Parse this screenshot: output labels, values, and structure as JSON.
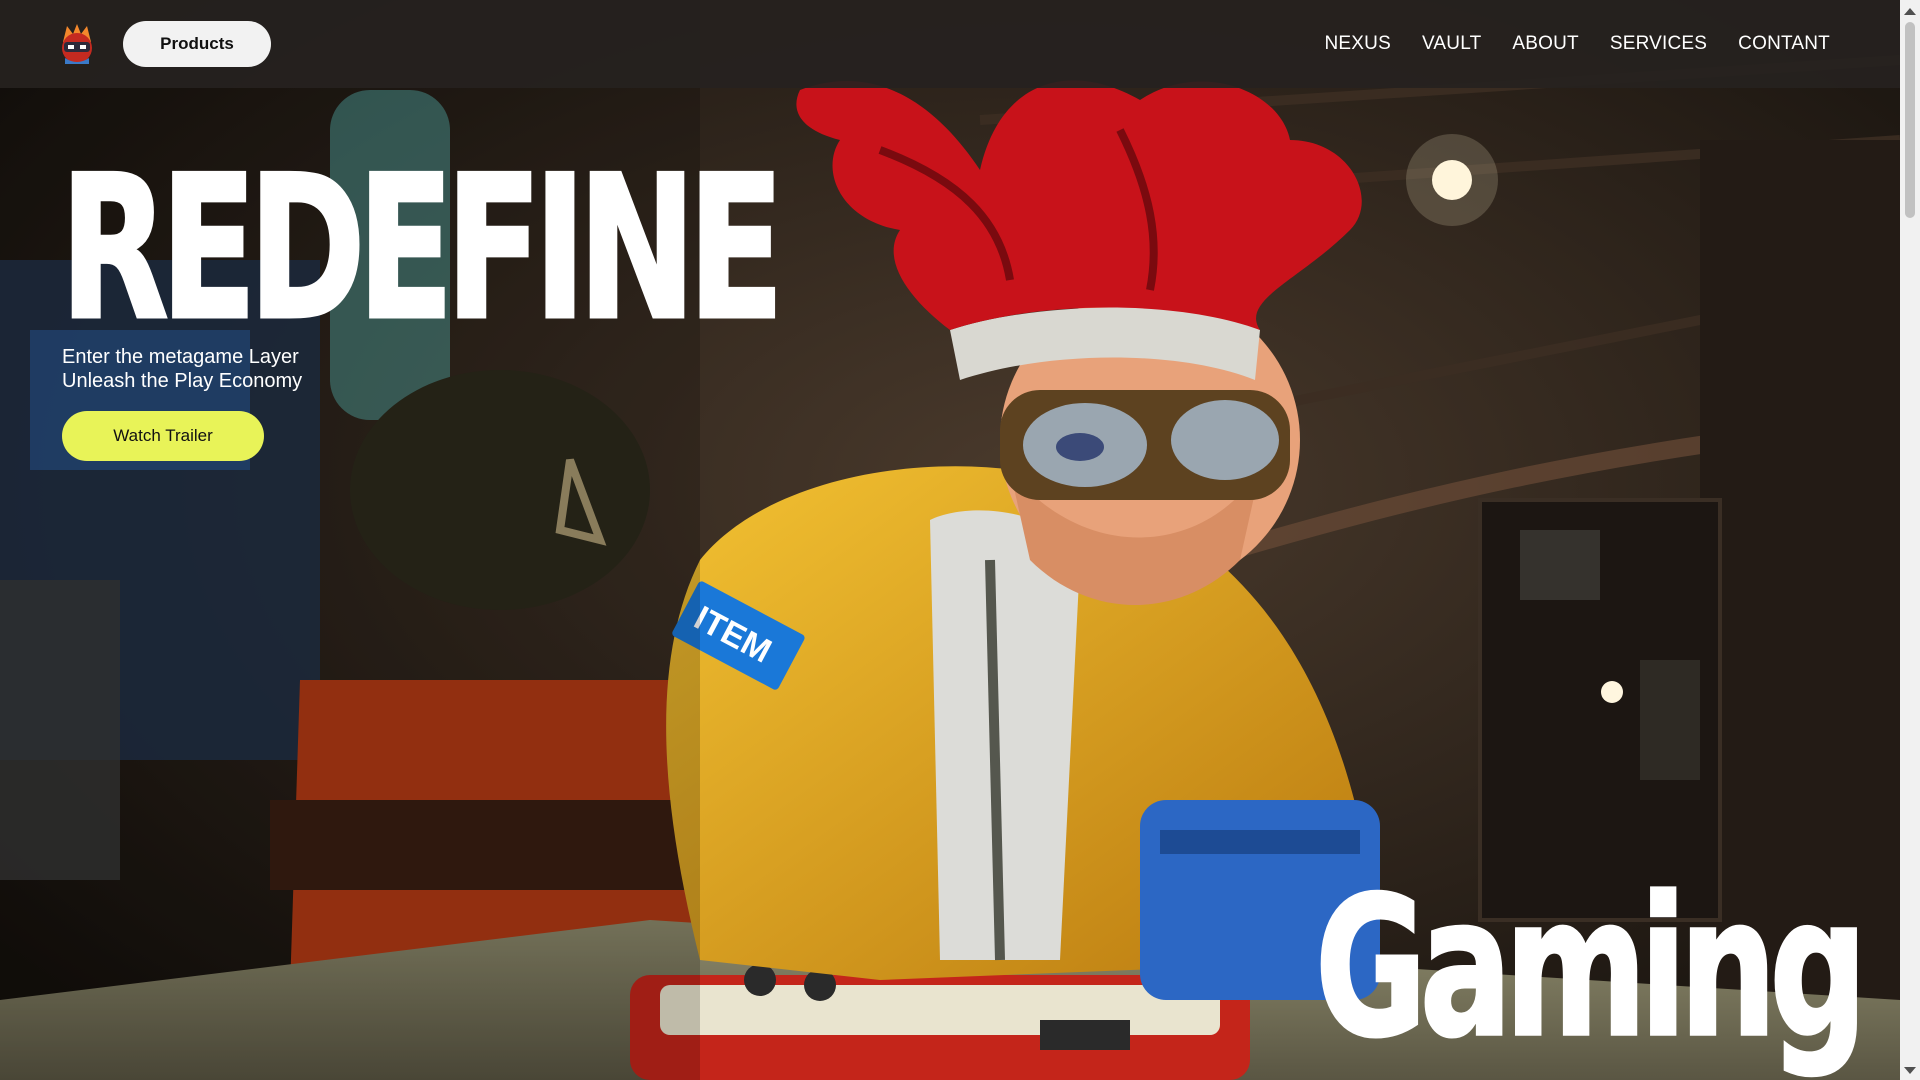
{
  "nav": {
    "products_label": "Products",
    "links": [
      "NEXUS",
      "VAULT",
      "ABOUT",
      "SERVICES",
      "CONTANT"
    ]
  },
  "hero": {
    "title": "REDEFINE",
    "subtitle_line1": "Enter the metagame Layer",
    "subtitle_line2": "Unleash the Play Economy",
    "cta_label": "Watch Trailer",
    "word_bottom": "Gaming",
    "badge_text": "ITEM"
  },
  "colors": {
    "accent": "#e8f358",
    "navbar_bg": "#262220",
    "hair": "#c8121a",
    "jacket": "#e8a81c"
  },
  "icons": {
    "logo": "ninja-mascot-icon"
  }
}
